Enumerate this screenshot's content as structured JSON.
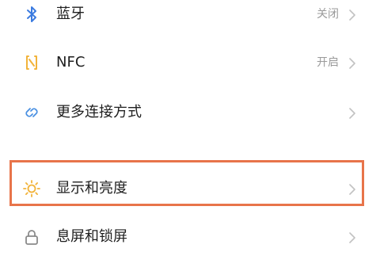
{
  "settings": {
    "bluetooth": {
      "label": "蓝牙",
      "status": "关闭",
      "icon": "bluetooth-icon"
    },
    "nfc": {
      "label": "NFC",
      "status": "开启",
      "icon": "nfc-icon"
    },
    "more_connections": {
      "label": "更多连接方式",
      "icon": "link-icon"
    },
    "display_brightness": {
      "label": "显示和亮度",
      "icon": "sun-icon"
    },
    "lock_screen": {
      "label": "息屏和锁屏",
      "icon": "lock-icon"
    }
  },
  "colors": {
    "bluetooth_icon": "#3b7be0",
    "nfc_icon": "#f2b33a",
    "link_icon": "#4a90e2",
    "sun_icon": "#f2b33a",
    "lock_icon": "#8a8a8a",
    "highlight_border": "#e8744a",
    "chevron": "#c2c2c2",
    "status_text": "#9a9a9a"
  }
}
